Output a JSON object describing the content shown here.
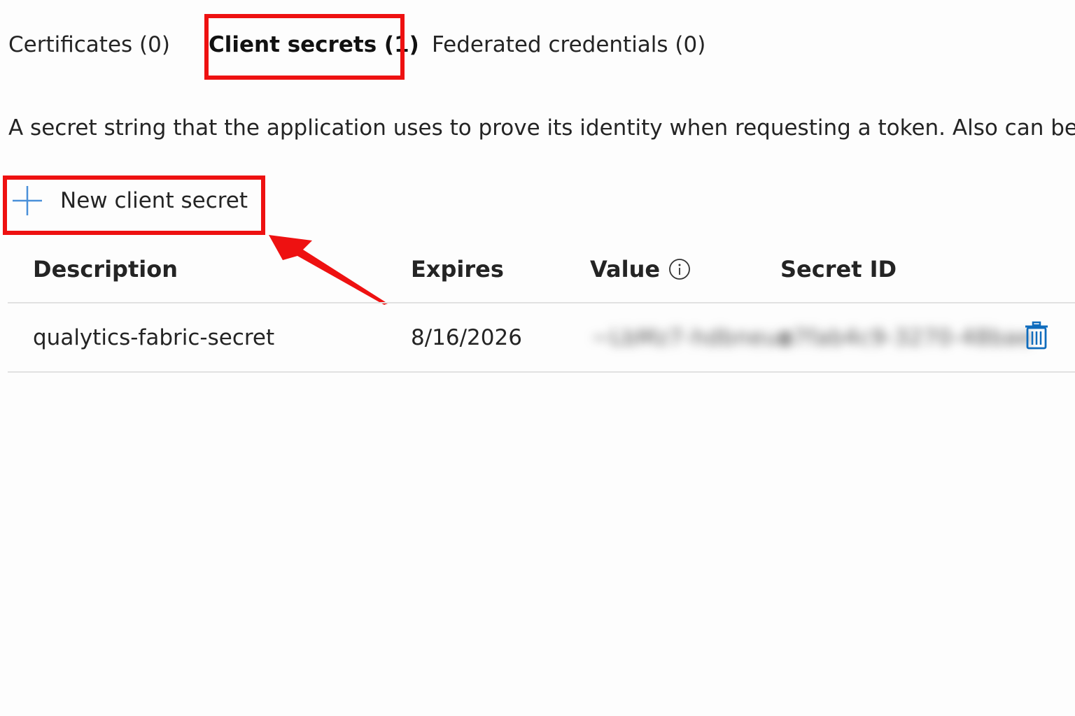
{
  "tabs": [
    {
      "label": "Certificates (0)"
    },
    {
      "label": "Client secrets (1)",
      "active": true
    },
    {
      "label": "Federated credentials (0)"
    }
  ],
  "description": "A secret string that the application uses to prove its identity when requesting a token. Also can be",
  "toolbar": {
    "new_secret_label": "New client secret",
    "new_secret_icon": "plus-icon"
  },
  "table": {
    "columns": {
      "description": "Description",
      "expires": "Expires",
      "value": "Value",
      "secret_id": "Secret ID"
    },
    "rows": [
      {
        "description": "qualytics-fabric-secret",
        "expires": "8/16/2026",
        "value": "~LbMz7-hdbneue",
        "secret_id": "a7fab4c9-3270-48bae",
        "delete_icon": "trash-icon"
      }
    ]
  },
  "colors": {
    "highlight": "#ee1111",
    "accent": "#0f6cbd",
    "divider": "#e1e1e1"
  }
}
